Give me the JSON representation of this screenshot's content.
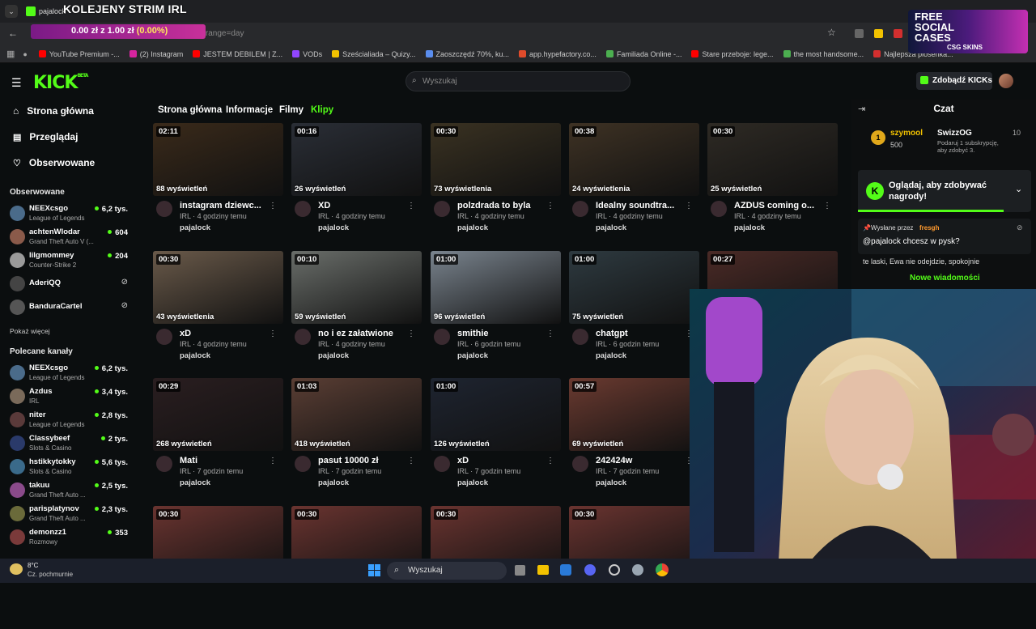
{
  "browser": {
    "tab_label": "pajalock",
    "url_text": "...ate&range=day",
    "overlay_title": "KOLEJENY STRIM IRL",
    "ticker": {
      "amount": "0.00 zł",
      "sep": "z",
      "goal": "1.00 zł",
      "pct": "(0.00%)"
    },
    "bookmarks": [
      {
        "label": "YouTube Premium -...",
        "color": "#ff0000"
      },
      {
        "label": "(2) Instagram",
        "color": "#d6249f"
      },
      {
        "label": "JESTEM DEBILEM | Z...",
        "color": "#ff0000"
      },
      {
        "label": "VODs",
        "color": "#9146ff"
      },
      {
        "label": "Sześcialiada – Quizy...",
        "color": "#f2c200"
      },
      {
        "label": "Zaoszczędź 70%, ku...",
        "color": "#5a8dee"
      },
      {
        "label": "app.hypefactory.co...",
        "color": "#e04b2b"
      },
      {
        "label": "Familiada Online -...",
        "color": "#4caf50"
      },
      {
        "label": "Stare przeboje: lege...",
        "color": "#ff0000"
      },
      {
        "label": "the most handsome...",
        "color": "#4caf50"
      },
      {
        "label": "Najlepsza piosenka...",
        "color": "#d32f2f"
      }
    ],
    "promo": {
      "line1": "FREE",
      "line2": "SOCIAL",
      "line3": "CASES",
      "brand": "CSG SKINS"
    }
  },
  "header": {
    "logo": "KICK",
    "logo_sup": "BETA",
    "search_placeholder": "Wyszukaj",
    "kicks_button": "Zdobądź KICKs"
  },
  "sidebar": {
    "nav": [
      "Strona główna",
      "Przeglądaj",
      "Obserwowane"
    ],
    "followed_title": "Obserwowane",
    "followed": [
      {
        "name": "NEEXcsgo",
        "category": "League of Legends",
        "viewers": "6,2 tys.",
        "color": "#4a6b8a"
      },
      {
        "name": "achtenWlodar",
        "category": "Grand Theft Auto V (...",
        "viewers": "604",
        "color": "#8a5a4a"
      },
      {
        "name": "lilgmommey",
        "category": "Counter-Strike 2",
        "viewers": "204",
        "color": "#9a9a9a"
      },
      {
        "name": "AderiQQ",
        "category": "",
        "viewers": "",
        "color": "#444"
      },
      {
        "name": "BanduraCartel",
        "category": "",
        "viewers": "",
        "color": "#555"
      }
    ],
    "show_more": "Pokaż więcej",
    "recommended_title": "Polecane kanały",
    "recommended": [
      {
        "name": "NEEXcsgo",
        "category": "League of Legends",
        "viewers": "6,2 tys.",
        "color": "#4a6b8a"
      },
      {
        "name": "Azdus",
        "category": "IRL",
        "viewers": "3,4 tys.",
        "color": "#7a6a5a"
      },
      {
        "name": "niter",
        "category": "League of Legends",
        "viewers": "2,8 tys.",
        "color": "#5a3a3a"
      },
      {
        "name": "Classybeef",
        "category": "Slots & Casino",
        "viewers": "2 tys.",
        "color": "#2a3a6a"
      },
      {
        "name": "hstikkytokky",
        "category": "Slots & Casino",
        "viewers": "5,6 tys.",
        "color": "#3a6a8a"
      },
      {
        "name": "takuu",
        "category": "Grand Theft Auto ...",
        "viewers": "2,5 tys.",
        "color": "#8a4a8a"
      },
      {
        "name": "parisplatynov",
        "category": "Grand Theft Auto ...",
        "viewers": "2,3 tys.",
        "color": "#6a6a3a"
      },
      {
        "name": "demonzz1",
        "category": "Rozmowy",
        "viewers": "353",
        "color": "#7a3a3a"
      }
    ]
  },
  "channel_tabs": [
    "Strona główna",
    "Informacje",
    "Filmy",
    "Klipy"
  ],
  "clips": [
    {
      "duration": "02:11",
      "views": "88 wyświetleń",
      "title": "instagram dziewc...",
      "meta": "IRL · 4 godziny temu",
      "user": "pajalock",
      "tint": "#3a2a1a"
    },
    {
      "duration": "00:16",
      "views": "26 wyświetleń",
      "title": "XD",
      "meta": "IRL · 4 godziny temu",
      "user": "pajalock",
      "tint": "#2a2e36"
    },
    {
      "duration": "00:30",
      "views": "73 wyświetlenia",
      "title": "polzdrada to byla",
      "meta": "IRL · 4 godziny temu",
      "user": "pajalock",
      "tint": "#3a3222"
    },
    {
      "duration": "00:38",
      "views": "24 wyświetlenia",
      "title": "Idealny soundtra...",
      "meta": "IRL · 4 godziny temu",
      "user": "pajalock",
      "tint": "#3e3224"
    },
    {
      "duration": "00:30",
      "views": "25 wyświetleń",
      "title": "AZDUS coming o...",
      "meta": "IRL · 4 godziny temu",
      "user": "pajalock",
      "tint": "#2e2a24"
    },
    {
      "duration": "00:30",
      "views": "43 wyświetlenia",
      "title": "xD",
      "meta": "IRL · 4 godziny temu",
      "user": "pajalock",
      "tint": "#6a5a4a"
    },
    {
      "duration": "00:10",
      "views": "59 wyświetleń",
      "title": "no i ez załatwione",
      "meta": "IRL · 4 godziny temu",
      "user": "pajalock",
      "tint": "#6a6e6a"
    },
    {
      "duration": "01:00",
      "views": "96 wyświetleń",
      "title": "smithie",
      "meta": "IRL · 6 godzin temu",
      "user": "pajalock",
      "tint": "#7a848e"
    },
    {
      "duration": "01:00",
      "views": "75 wyświetleń",
      "title": "chatgpt",
      "meta": "IRL · 6 godzin temu",
      "user": "pajalock",
      "tint": "#2e3a40"
    },
    {
      "duration": "00:27",
      "views": "",
      "title": "",
      "meta": "",
      "user": "",
      "tint": "#4a2a26"
    },
    {
      "duration": "00:29",
      "views": "268 wyświetleń",
      "title": "Mati",
      "meta": "IRL · 7 godzin temu",
      "user": "pajalock",
      "tint": "#2a1e20"
    },
    {
      "duration": "01:03",
      "views": "418 wyświetleń",
      "title": "pasut 10000 zł",
      "meta": "IRL · 7 godzin temu",
      "user": "pajalock",
      "tint": "#5a3e34"
    },
    {
      "duration": "01:00",
      "views": "126 wyświetleń",
      "title": "xD",
      "meta": "IRL · 7 godzin temu",
      "user": "pajalock",
      "tint": "#1e2430"
    },
    {
      "duration": "00:57",
      "views": "69 wyświetleń",
      "title": "242424w",
      "meta": "IRL · 7 godzin temu",
      "user": "pajalock",
      "tint": "#6a3a30"
    },
    {
      "duration": "00:30",
      "views": "",
      "title": "",
      "meta": "",
      "user": "",
      "tint": "#6a3430"
    },
    {
      "duration": "00:30",
      "views": "",
      "title": "",
      "meta": "",
      "user": "",
      "tint": "#6a3430"
    },
    {
      "duration": "00:30",
      "views": "",
      "title": "",
      "meta": "",
      "user": "",
      "tint": "#6a3430"
    },
    {
      "duration": "00:30",
      "views": "",
      "title": "",
      "meta": "",
      "user": "",
      "tint": "#6a3430"
    }
  ],
  "chat": {
    "title": "Czat",
    "top_user": "szymool",
    "top_value": "500",
    "sub_user": "SwizzOG",
    "sub_count": "10",
    "sub_text": "Podaruj 1 subskrypcję, aby zdobyć 3.",
    "watch_banner": "Oglądaj, aby zdobywać nagrody!",
    "sent_by_label": "Wysłane przez",
    "sent_by_user": "fresgh",
    "pinned_message": "@pajalock chcesz w pysk?",
    "chat_line": "te laski, Ewa nie odejdzie, spokojnie",
    "new_messages": "Nowe wiadomości"
  },
  "taskbar": {
    "temp": "8°C",
    "weather": "Cz. pochmurnie",
    "search": "Wyszukaj"
  }
}
